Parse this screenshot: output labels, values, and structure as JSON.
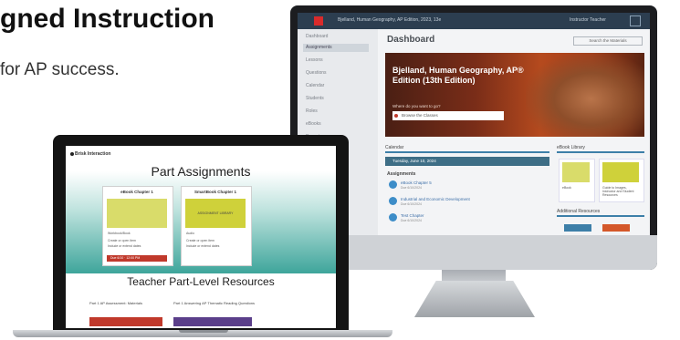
{
  "page": {
    "headline": "gned Instruction",
    "subline": "for AP success."
  },
  "monitor": {
    "topbar": {
      "title": "Bjelland, Human Geography, AP Edition, 2023, 13e",
      "user": "Instructor Teacher"
    },
    "sidebar": {
      "items": [
        "Dashboard",
        "Assignments",
        "Lessons",
        "Questions",
        "Calendar",
        "Students",
        "Roles",
        "eBooks",
        "Reports"
      ]
    },
    "dashboard_title": "Dashboard",
    "top_button": "Search the Materials",
    "hero": {
      "title": "Bjelland, Human Geography, AP® Edition (13th Edition)",
      "question": "Where do you want to go?",
      "input_value": "Browse the Classes"
    },
    "calendar": {
      "heading": "Calendar",
      "bar_text": "Tuesday, June 10, 2024",
      "assignments_heading": "Assignments",
      "assignments": [
        {
          "title": "eBook Chapter 5",
          "sub": "Due 6/10/2024"
        },
        {
          "title": "Industrial and Economic Development",
          "sub": "Due 6/10/2024"
        },
        {
          "title": "Test Chapter",
          "sub": "Due 6/10/2024"
        }
      ]
    },
    "ebook": {
      "heading": "eBook Library",
      "card1_label": "eBook",
      "card2_label": "Guide to Images, Instructor and Student Resources"
    },
    "additional_heading": "Additional Resources",
    "colors": {
      "accent": "#3d7fa8",
      "hero": "#7a2d18",
      "brand": "#d92b2b"
    }
  },
  "laptop": {
    "brand": "Brisk Interaction",
    "heading": "Part Assignments",
    "cards": [
      {
        "title": "eBook Chapter 1",
        "meta1": "Workbook/Book",
        "meta2": "Create or open item",
        "meta3": "Include or extend dates",
        "red_label": "Due 6/10 · 12:00 PM"
      },
      {
        "title": "SmartBook Chapter 1",
        "image_label": "ASSIGNMENT LIBRARY",
        "meta1": "Audio",
        "meta2": "Create or open item",
        "meta3": "Include or extend dates"
      }
    ],
    "lower_heading": "Teacher Part-Level Resources",
    "resources": [
      {
        "text": "Part 1 AP Assessment: Materials"
      },
      {
        "text": "Part 1 Answering AP Thematic Reading Questions"
      }
    ],
    "colors": {
      "teal": "#3ea59b",
      "red": "#c0392b",
      "purple": "#5b3f8a"
    }
  }
}
